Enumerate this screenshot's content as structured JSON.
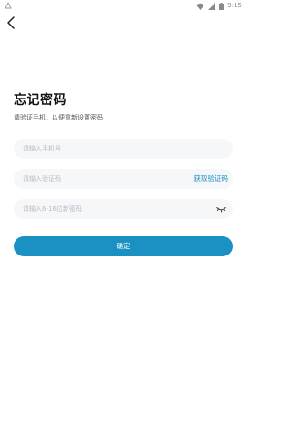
{
  "status_bar": {
    "time": "9:15",
    "icons": [
      "alert-icon",
      "wifi-icon",
      "signal-icon",
      "battery-icon"
    ]
  },
  "nav": {
    "back_icon": "chevron-left-icon"
  },
  "header": {
    "title": "忘记密码",
    "subtitle": "请验证手机，以便重新设置密码"
  },
  "form": {
    "phone": {
      "placeholder": "请输入手机号",
      "value": ""
    },
    "code": {
      "placeholder": "请输入验证码",
      "value": "",
      "get_code_label": "获取验证码"
    },
    "password": {
      "placeholder": "请输入6-16位新密码",
      "value": "",
      "visibility_icon": "eye-closed-icon"
    },
    "confirm_label": "确定"
  },
  "colors": {
    "accent": "#1b91c3",
    "field_background": "#f6f7f9",
    "placeholder": "#b9bcc2"
  }
}
